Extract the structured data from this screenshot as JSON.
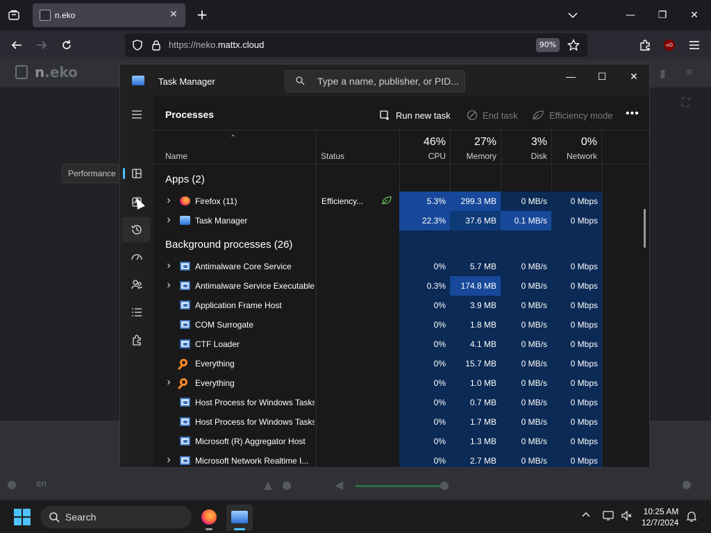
{
  "browser": {
    "tab_title": "n.eko",
    "url_scheme": "https://neko.",
    "url_domain": "mattx.cloud",
    "zoom": "90%",
    "ublock_badge": "uO"
  },
  "neko": {
    "logo_n": "n",
    "logo_rest": ".eko",
    "language": "en"
  },
  "tooltip": "Performance",
  "task_manager": {
    "title": "Task Manager",
    "search_placeholder": "Type a name, publisher, or PID...",
    "page_title": "Processes",
    "run_new_task": "Run new task",
    "end_task": "End task",
    "efficiency_mode": "Efficiency mode",
    "columns": {
      "name": "Name",
      "status": "Status",
      "cpu_pct": "46%",
      "cpu": "CPU",
      "memory_pct": "27%",
      "memory": "Memory",
      "disk_pct": "3%",
      "disk": "Disk",
      "network_pct": "0%",
      "network": "Network"
    },
    "groups": {
      "apps": "Apps (2)",
      "background": "Background processes (26)"
    },
    "apps": [
      {
        "name": "Firefox (11)",
        "status": "Efficiency...",
        "cpu": "5.3%",
        "memory": "299.3 MB",
        "disk": "0 MB/s",
        "network": "0 Mbps",
        "expandable": true,
        "icon": "firefox-icon"
      },
      {
        "name": "Task Manager",
        "status": "",
        "cpu": "22.3%",
        "memory": "37.6 MB",
        "disk": "0.1 MB/s",
        "network": "0 Mbps",
        "expandable": true,
        "icon": "task-manager-icon"
      }
    ],
    "background": [
      {
        "name": "Antimalware Core Service",
        "cpu": "0%",
        "memory": "5.7 MB",
        "disk": "0 MB/s",
        "network": "0 Mbps",
        "expandable": true,
        "icon": "window-icon"
      },
      {
        "name": "Antimalware Service Executable",
        "cpu": "0.3%",
        "memory": "174.8 MB",
        "disk": "0 MB/s",
        "network": "0 Mbps",
        "expandable": true,
        "icon": "window-icon"
      },
      {
        "name": "Application Frame Host",
        "cpu": "0%",
        "memory": "3.9 MB",
        "disk": "0 MB/s",
        "network": "0 Mbps",
        "expandable": false,
        "icon": "window-icon"
      },
      {
        "name": "COM Surrogate",
        "cpu": "0%",
        "memory": "1.8 MB",
        "disk": "0 MB/s",
        "network": "0 Mbps",
        "expandable": false,
        "icon": "window-icon"
      },
      {
        "name": "CTF Loader",
        "cpu": "0%",
        "memory": "4.1 MB",
        "disk": "0 MB/s",
        "network": "0 Mbps",
        "expandable": false,
        "icon": "window-icon"
      },
      {
        "name": "Everything",
        "cpu": "0%",
        "memory": "15.7 MB",
        "disk": "0 MB/s",
        "network": "0 Mbps",
        "expandable": false,
        "icon": "everything-icon"
      },
      {
        "name": "Everything",
        "cpu": "0%",
        "memory": "1.0 MB",
        "disk": "0 MB/s",
        "network": "0 Mbps",
        "expandable": true,
        "icon": "everything-icon"
      },
      {
        "name": "Host Process for Windows Tasks",
        "cpu": "0%",
        "memory": "0.7 MB",
        "disk": "0 MB/s",
        "network": "0 Mbps",
        "expandable": false,
        "icon": "window-icon"
      },
      {
        "name": "Host Process for Windows Tasks",
        "cpu": "0%",
        "memory": "1.7 MB",
        "disk": "0 MB/s",
        "network": "0 Mbps",
        "expandable": false,
        "icon": "window-icon"
      },
      {
        "name": "Microsoft (R) Aggregator Host",
        "cpu": "0%",
        "memory": "1.3 MB",
        "disk": "0 MB/s",
        "network": "0 Mbps",
        "expandable": false,
        "icon": "window-icon"
      },
      {
        "name": "Microsoft Network Realtime I...",
        "cpu": "0%",
        "memory": "2.7 MB",
        "disk": "0 MB/s",
        "network": "0 Mbps",
        "expandable": true,
        "icon": "window-icon"
      }
    ]
  },
  "taskbar": {
    "search_label": "Search",
    "time": "10:25 AM",
    "date": "12/7/2024"
  },
  "colors": {
    "heat_low": "#0b2a55",
    "heat_mid": "#0e3a78",
    "heat_high": "#17489a",
    "accent": "#4cc2ff"
  }
}
